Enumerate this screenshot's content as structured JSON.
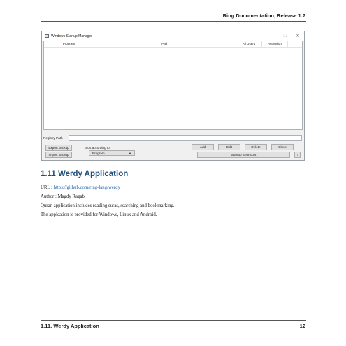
{
  "doc": {
    "header": "Ring Documentation, Release 1.7",
    "footer_section": "1.11.  Werdy Application",
    "footer_page": "12"
  },
  "window": {
    "title": "Windows Startup Manager",
    "controls": {
      "minimize": "—",
      "maximize": "☐",
      "close": "✕"
    },
    "columns": [
      "Program",
      "Path",
      "All Users",
      "Activation"
    ],
    "registry_label": "Registry Path",
    "registry_value": "",
    "buttons": {
      "export": "Export backup",
      "import": "Import backup",
      "add": "Add",
      "edit": "Edit",
      "delete": "Delete",
      "close": "Close",
      "startup_shortcuts": "Startup Shortcuts",
      "help": "?"
    },
    "sort_label": "Sort according to:",
    "sort_selected": "Program"
  },
  "section": {
    "title": "1.11  Werdy Application",
    "url_label": "URL : ",
    "url": "https://github.com/ring-lang/werdy",
    "author": "Author : Magdy Ragab",
    "desc1": "Quran application includes reading suras, searching and bookmarking.",
    "desc2": "The applcation is provided for Windows, Linux and Android."
  }
}
